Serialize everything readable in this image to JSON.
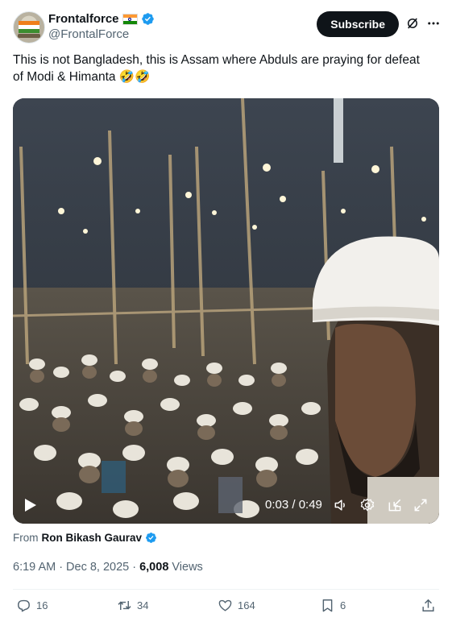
{
  "author": {
    "display_name": "Frontalforce",
    "handle": "@FrontalForce"
  },
  "header": {
    "subscribe_label": "Subscribe"
  },
  "tweet": {
    "text": "This is not Bangladesh, this is Assam where Abduls are praying for defeat of Modi & Himanta 🤣🤣"
  },
  "video": {
    "time": "0:03 / 0:49",
    "progress": 0.06,
    "icons": [
      "play-icon",
      "volume-icon",
      "settings-icon",
      "pip-icon",
      "fullscreen-icon"
    ]
  },
  "attribution": {
    "prefix": "From",
    "name": "Ron Bikash Gaurav"
  },
  "meta": {
    "time": "6:19 AM",
    "sep1": "·",
    "date": "Dec 8, 2025",
    "sep2": "·",
    "views_count": "6,008",
    "views_label": "Views"
  },
  "actions": {
    "replies": "16",
    "reposts": "34",
    "likes": "164",
    "bookmarks": "6"
  },
  "colors": {
    "verified": "#1d9bf0",
    "text": "#0f1419",
    "muted": "#536471"
  }
}
